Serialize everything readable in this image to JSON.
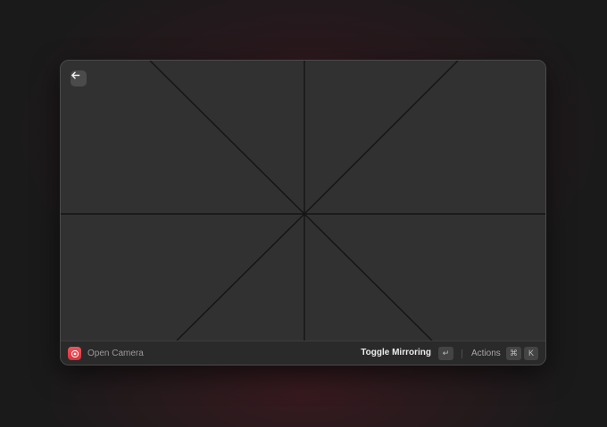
{
  "camera": {
    "back_icon": "arrow-left-icon"
  },
  "action_bar": {
    "app_icon": "camera-app-icon",
    "app_icon_color": "#e8434c",
    "title": "Open Camera",
    "primary_action": "Toggle Mirroring",
    "primary_shortcut": "↵",
    "actions_label": "Actions",
    "actions_shortcut_modifier": "⌘",
    "actions_shortcut_key": "K"
  }
}
